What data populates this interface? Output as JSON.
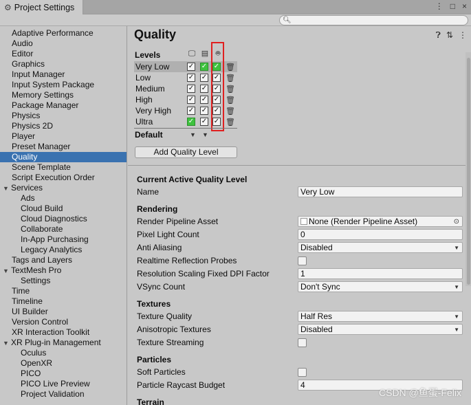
{
  "window": {
    "tab_title": "Project Settings",
    "controls": [
      "⋮",
      "□",
      "×"
    ]
  },
  "search": {
    "placeholder": "",
    "icon": "search-icon"
  },
  "sidebar": {
    "items": [
      {
        "label": "Adaptive Performance",
        "level": 0
      },
      {
        "label": "Audio",
        "level": 0
      },
      {
        "label": "Editor",
        "level": 0
      },
      {
        "label": "Graphics",
        "level": 0
      },
      {
        "label": "Input Manager",
        "level": 0
      },
      {
        "label": "Input System Package",
        "level": 0
      },
      {
        "label": "Memory Settings",
        "level": 0
      },
      {
        "label": "Package Manager",
        "level": 0
      },
      {
        "label": "Physics",
        "level": 0
      },
      {
        "label": "Physics 2D",
        "level": 0
      },
      {
        "label": "Player",
        "level": 0
      },
      {
        "label": "Preset Manager",
        "level": 0
      },
      {
        "label": "Quality",
        "level": 0,
        "selected": true
      },
      {
        "label": "Scene Template",
        "level": 0
      },
      {
        "label": "Script Execution Order",
        "level": 0
      },
      {
        "label": "Services",
        "level": 0,
        "expandable": true
      },
      {
        "label": "Ads",
        "level": 1
      },
      {
        "label": "Cloud Build",
        "level": 1
      },
      {
        "label": "Cloud Diagnostics",
        "level": 1
      },
      {
        "label": "Collaborate",
        "level": 1
      },
      {
        "label": "In-App Purchasing",
        "level": 1
      },
      {
        "label": "Legacy Analytics",
        "level": 1
      },
      {
        "label": "Tags and Layers",
        "level": 0
      },
      {
        "label": "TextMesh Pro",
        "level": 0,
        "expandable": true
      },
      {
        "label": "Settings",
        "level": 1
      },
      {
        "label": "Time",
        "level": 0
      },
      {
        "label": "Timeline",
        "level": 0
      },
      {
        "label": "UI Builder",
        "level": 0
      },
      {
        "label": "Version Control",
        "level": 0
      },
      {
        "label": "XR Interaction Toolkit",
        "level": 0
      },
      {
        "label": "XR Plug-in Management",
        "level": 0,
        "expandable": true
      },
      {
        "label": "Oculus",
        "level": 1
      },
      {
        "label": "OpenXR",
        "level": 1
      },
      {
        "label": "PICO",
        "level": 1
      },
      {
        "label": "PICO Live Preview",
        "level": 1
      },
      {
        "label": "Project Validation",
        "level": 1
      }
    ]
  },
  "main": {
    "title": "Quality",
    "levels_header": "Levels",
    "platforms": [
      "monitor-icon",
      "server-icon",
      "android-icon"
    ],
    "levels": [
      {
        "name": "Very Low",
        "selected": true,
        "checks": [
          "on",
          "green",
          "green"
        ]
      },
      {
        "name": "Low",
        "checks": [
          "on",
          "on",
          "on"
        ]
      },
      {
        "name": "Medium",
        "checks": [
          "on",
          "on",
          "on"
        ]
      },
      {
        "name": "High",
        "checks": [
          "on",
          "on",
          "on"
        ]
      },
      {
        "name": "Very High",
        "checks": [
          "on",
          "on",
          "on"
        ]
      },
      {
        "name": "Ultra",
        "checks": [
          "green",
          "on",
          "on"
        ]
      }
    ],
    "default_label": "Default",
    "add_button": "Add Quality Level",
    "current_section": "Current Active Quality Level",
    "name_label": "Name",
    "name_value": "Very Low",
    "rendering": {
      "header": "Rendering",
      "render_pipeline_label": "Render Pipeline Asset",
      "render_pipeline_value": "None (Render Pipeline Asset)",
      "pixel_light_label": "Pixel Light Count",
      "pixel_light_value": "0",
      "anti_aliasing_label": "Anti Aliasing",
      "anti_aliasing_value": "Disabled",
      "realtime_reflection_label": "Realtime Reflection Probes",
      "res_scaling_label": "Resolution Scaling Fixed DPI Factor",
      "res_scaling_value": "1",
      "vsync_label": "VSync Count",
      "vsync_value": "Don't Sync"
    },
    "textures": {
      "header": "Textures",
      "quality_label": "Texture Quality",
      "quality_value": "Half Res",
      "aniso_label": "Anisotropic Textures",
      "aniso_value": "Disabled",
      "streaming_label": "Texture Streaming"
    },
    "particles": {
      "header": "Particles",
      "soft_label": "Soft Particles",
      "raycast_label": "Particle Raycast Budget",
      "raycast_value": "4"
    },
    "terrain_header": "Terrain"
  },
  "watermark": "CSDN @鱼蛋-Felix"
}
